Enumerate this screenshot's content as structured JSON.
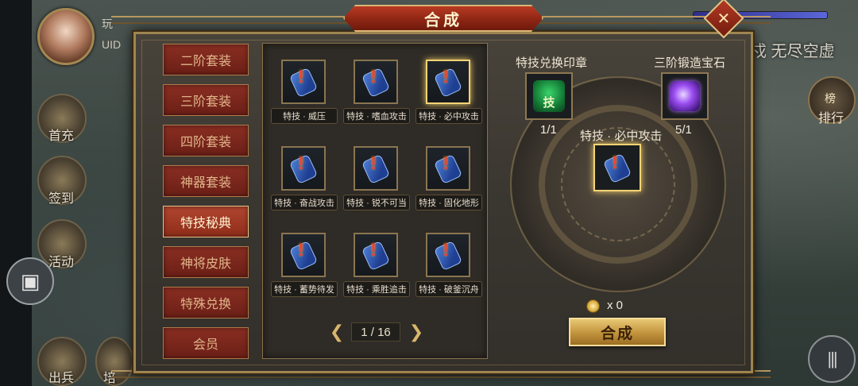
{
  "window": {
    "title": "合成"
  },
  "player": {
    "name": "玩",
    "uid_label": "UID"
  },
  "background_banner": "戍 无尽空虚",
  "side_menu": [
    {
      "label": "首充"
    },
    {
      "label": "签到"
    },
    {
      "label": "活动"
    },
    {
      "label": "出兵"
    },
    {
      "label": "培"
    }
  ],
  "right_menu": {
    "label": "排行",
    "glyph": "榜"
  },
  "tabs": [
    {
      "label": "二阶套装",
      "active": false
    },
    {
      "label": "三阶套装",
      "active": false
    },
    {
      "label": "四阶套装",
      "active": false
    },
    {
      "label": "神器套装",
      "active": false
    },
    {
      "label": "特技秘典",
      "active": true
    },
    {
      "label": "神将皮肤",
      "active": false
    },
    {
      "label": "特殊兑换",
      "active": false
    },
    {
      "label": "会员",
      "active": false
    }
  ],
  "items": [
    {
      "label": "特技 · 威压",
      "selected": false
    },
    {
      "label": "特技 · 嗜血攻击",
      "selected": false
    },
    {
      "label": "特技 · 必中攻击",
      "selected": true
    },
    {
      "label": "特技 · 奋战攻击",
      "selected": false
    },
    {
      "label": "特技 · 锐不可当",
      "selected": false
    },
    {
      "label": "特技 · 固化地形",
      "selected": false
    },
    {
      "label": "特技 · 蓄势待发",
      "selected": false
    },
    {
      "label": "特技 · 乘胜追击",
      "selected": false
    },
    {
      "label": "特技 · 破釜沉舟",
      "selected": false
    }
  ],
  "pager": {
    "text": "1 / 16"
  },
  "synthesis": {
    "material_a": {
      "label": "特技兑换印章",
      "count": "1/1",
      "icon_glyph": "技"
    },
    "material_b": {
      "label": "三阶锻造宝石",
      "count": "5/1"
    },
    "result": {
      "label": "特技 · 必中攻击"
    },
    "cost": {
      "value": "x 0"
    },
    "button_label": "合成"
  },
  "colors": {
    "title_plate": "#8e2614",
    "tab_active": "#b14630",
    "highlight": "#f3d374",
    "button": "#c2933d"
  }
}
